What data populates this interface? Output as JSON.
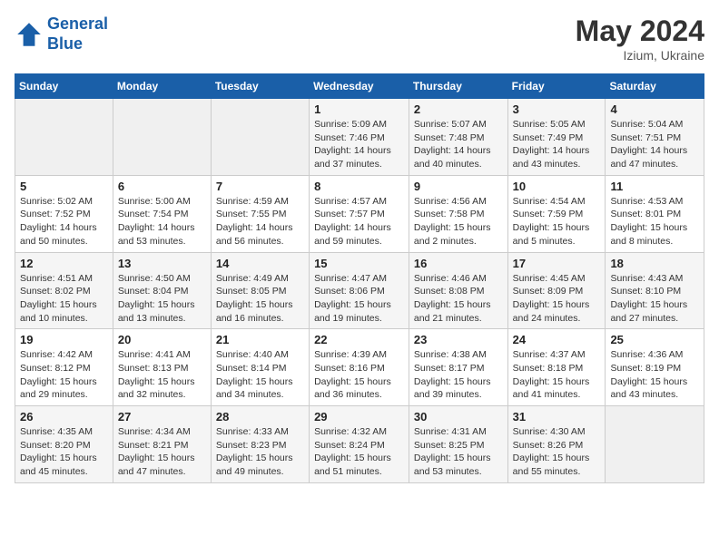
{
  "header": {
    "logo_line1": "General",
    "logo_line2": "Blue",
    "month_year": "May 2024",
    "location": "Izium, Ukraine"
  },
  "weekdays": [
    "Sunday",
    "Monday",
    "Tuesday",
    "Wednesday",
    "Thursday",
    "Friday",
    "Saturday"
  ],
  "weeks": [
    [
      {
        "day": "",
        "content": ""
      },
      {
        "day": "",
        "content": ""
      },
      {
        "day": "",
        "content": ""
      },
      {
        "day": "1",
        "content": "Sunrise: 5:09 AM\nSunset: 7:46 PM\nDaylight: 14 hours\nand 37 minutes."
      },
      {
        "day": "2",
        "content": "Sunrise: 5:07 AM\nSunset: 7:48 PM\nDaylight: 14 hours\nand 40 minutes."
      },
      {
        "day": "3",
        "content": "Sunrise: 5:05 AM\nSunset: 7:49 PM\nDaylight: 14 hours\nand 43 minutes."
      },
      {
        "day": "4",
        "content": "Sunrise: 5:04 AM\nSunset: 7:51 PM\nDaylight: 14 hours\nand 47 minutes."
      }
    ],
    [
      {
        "day": "5",
        "content": "Sunrise: 5:02 AM\nSunset: 7:52 PM\nDaylight: 14 hours\nand 50 minutes."
      },
      {
        "day": "6",
        "content": "Sunrise: 5:00 AM\nSunset: 7:54 PM\nDaylight: 14 hours\nand 53 minutes."
      },
      {
        "day": "7",
        "content": "Sunrise: 4:59 AM\nSunset: 7:55 PM\nDaylight: 14 hours\nand 56 minutes."
      },
      {
        "day": "8",
        "content": "Sunrise: 4:57 AM\nSunset: 7:57 PM\nDaylight: 14 hours\nand 59 minutes."
      },
      {
        "day": "9",
        "content": "Sunrise: 4:56 AM\nSunset: 7:58 PM\nDaylight: 15 hours\nand 2 minutes."
      },
      {
        "day": "10",
        "content": "Sunrise: 4:54 AM\nSunset: 7:59 PM\nDaylight: 15 hours\nand 5 minutes."
      },
      {
        "day": "11",
        "content": "Sunrise: 4:53 AM\nSunset: 8:01 PM\nDaylight: 15 hours\nand 8 minutes."
      }
    ],
    [
      {
        "day": "12",
        "content": "Sunrise: 4:51 AM\nSunset: 8:02 PM\nDaylight: 15 hours\nand 10 minutes."
      },
      {
        "day": "13",
        "content": "Sunrise: 4:50 AM\nSunset: 8:04 PM\nDaylight: 15 hours\nand 13 minutes."
      },
      {
        "day": "14",
        "content": "Sunrise: 4:49 AM\nSunset: 8:05 PM\nDaylight: 15 hours\nand 16 minutes."
      },
      {
        "day": "15",
        "content": "Sunrise: 4:47 AM\nSunset: 8:06 PM\nDaylight: 15 hours\nand 19 minutes."
      },
      {
        "day": "16",
        "content": "Sunrise: 4:46 AM\nSunset: 8:08 PM\nDaylight: 15 hours\nand 21 minutes."
      },
      {
        "day": "17",
        "content": "Sunrise: 4:45 AM\nSunset: 8:09 PM\nDaylight: 15 hours\nand 24 minutes."
      },
      {
        "day": "18",
        "content": "Sunrise: 4:43 AM\nSunset: 8:10 PM\nDaylight: 15 hours\nand 27 minutes."
      }
    ],
    [
      {
        "day": "19",
        "content": "Sunrise: 4:42 AM\nSunset: 8:12 PM\nDaylight: 15 hours\nand 29 minutes."
      },
      {
        "day": "20",
        "content": "Sunrise: 4:41 AM\nSunset: 8:13 PM\nDaylight: 15 hours\nand 32 minutes."
      },
      {
        "day": "21",
        "content": "Sunrise: 4:40 AM\nSunset: 8:14 PM\nDaylight: 15 hours\nand 34 minutes."
      },
      {
        "day": "22",
        "content": "Sunrise: 4:39 AM\nSunset: 8:16 PM\nDaylight: 15 hours\nand 36 minutes."
      },
      {
        "day": "23",
        "content": "Sunrise: 4:38 AM\nSunset: 8:17 PM\nDaylight: 15 hours\nand 39 minutes."
      },
      {
        "day": "24",
        "content": "Sunrise: 4:37 AM\nSunset: 8:18 PM\nDaylight: 15 hours\nand 41 minutes."
      },
      {
        "day": "25",
        "content": "Sunrise: 4:36 AM\nSunset: 8:19 PM\nDaylight: 15 hours\nand 43 minutes."
      }
    ],
    [
      {
        "day": "26",
        "content": "Sunrise: 4:35 AM\nSunset: 8:20 PM\nDaylight: 15 hours\nand 45 minutes."
      },
      {
        "day": "27",
        "content": "Sunrise: 4:34 AM\nSunset: 8:21 PM\nDaylight: 15 hours\nand 47 minutes."
      },
      {
        "day": "28",
        "content": "Sunrise: 4:33 AM\nSunset: 8:23 PM\nDaylight: 15 hours\nand 49 minutes."
      },
      {
        "day": "29",
        "content": "Sunrise: 4:32 AM\nSunset: 8:24 PM\nDaylight: 15 hours\nand 51 minutes."
      },
      {
        "day": "30",
        "content": "Sunrise: 4:31 AM\nSunset: 8:25 PM\nDaylight: 15 hours\nand 53 minutes."
      },
      {
        "day": "31",
        "content": "Sunrise: 4:30 AM\nSunset: 8:26 PM\nDaylight: 15 hours\nand 55 minutes."
      },
      {
        "day": "",
        "content": ""
      }
    ]
  ]
}
